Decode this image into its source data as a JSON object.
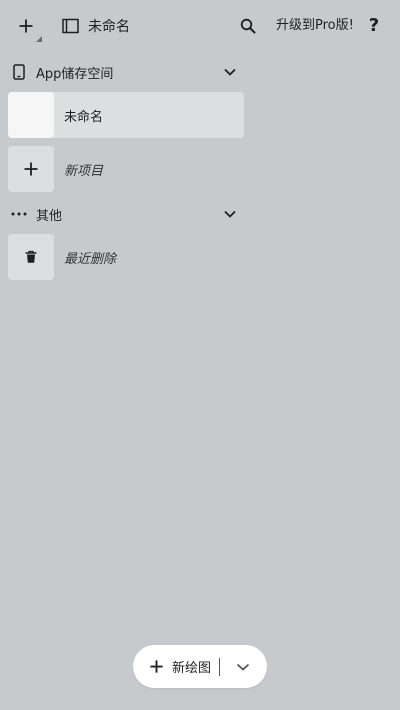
{
  "topbar": {
    "add_icon": "plus-icon",
    "doc_title": "未命名",
    "doc_icon": "document-sidebar-icon",
    "search_icon": "search-icon",
    "upgrade_label": "升级到Pro版!",
    "help_label": "?"
  },
  "sections": [
    {
      "label": "App储存空间",
      "icon": "tablet-icon",
      "items": [
        {
          "label": "未命名",
          "selected": true
        },
        {
          "label": "新项目",
          "icon": "plus-icon"
        }
      ]
    },
    {
      "label": "其他",
      "icon": "more-horizontal-icon",
      "items": [
        {
          "label": "最近删除",
          "icon": "trash-icon"
        }
      ]
    }
  ],
  "bottom": {
    "new_drawing_label": "新绘图",
    "dropdown_icon": "chevron-down-icon"
  },
  "colors": {
    "background": "#c6cacd",
    "selected_item": "#dcdfe0",
    "pill": "#ffffff"
  }
}
